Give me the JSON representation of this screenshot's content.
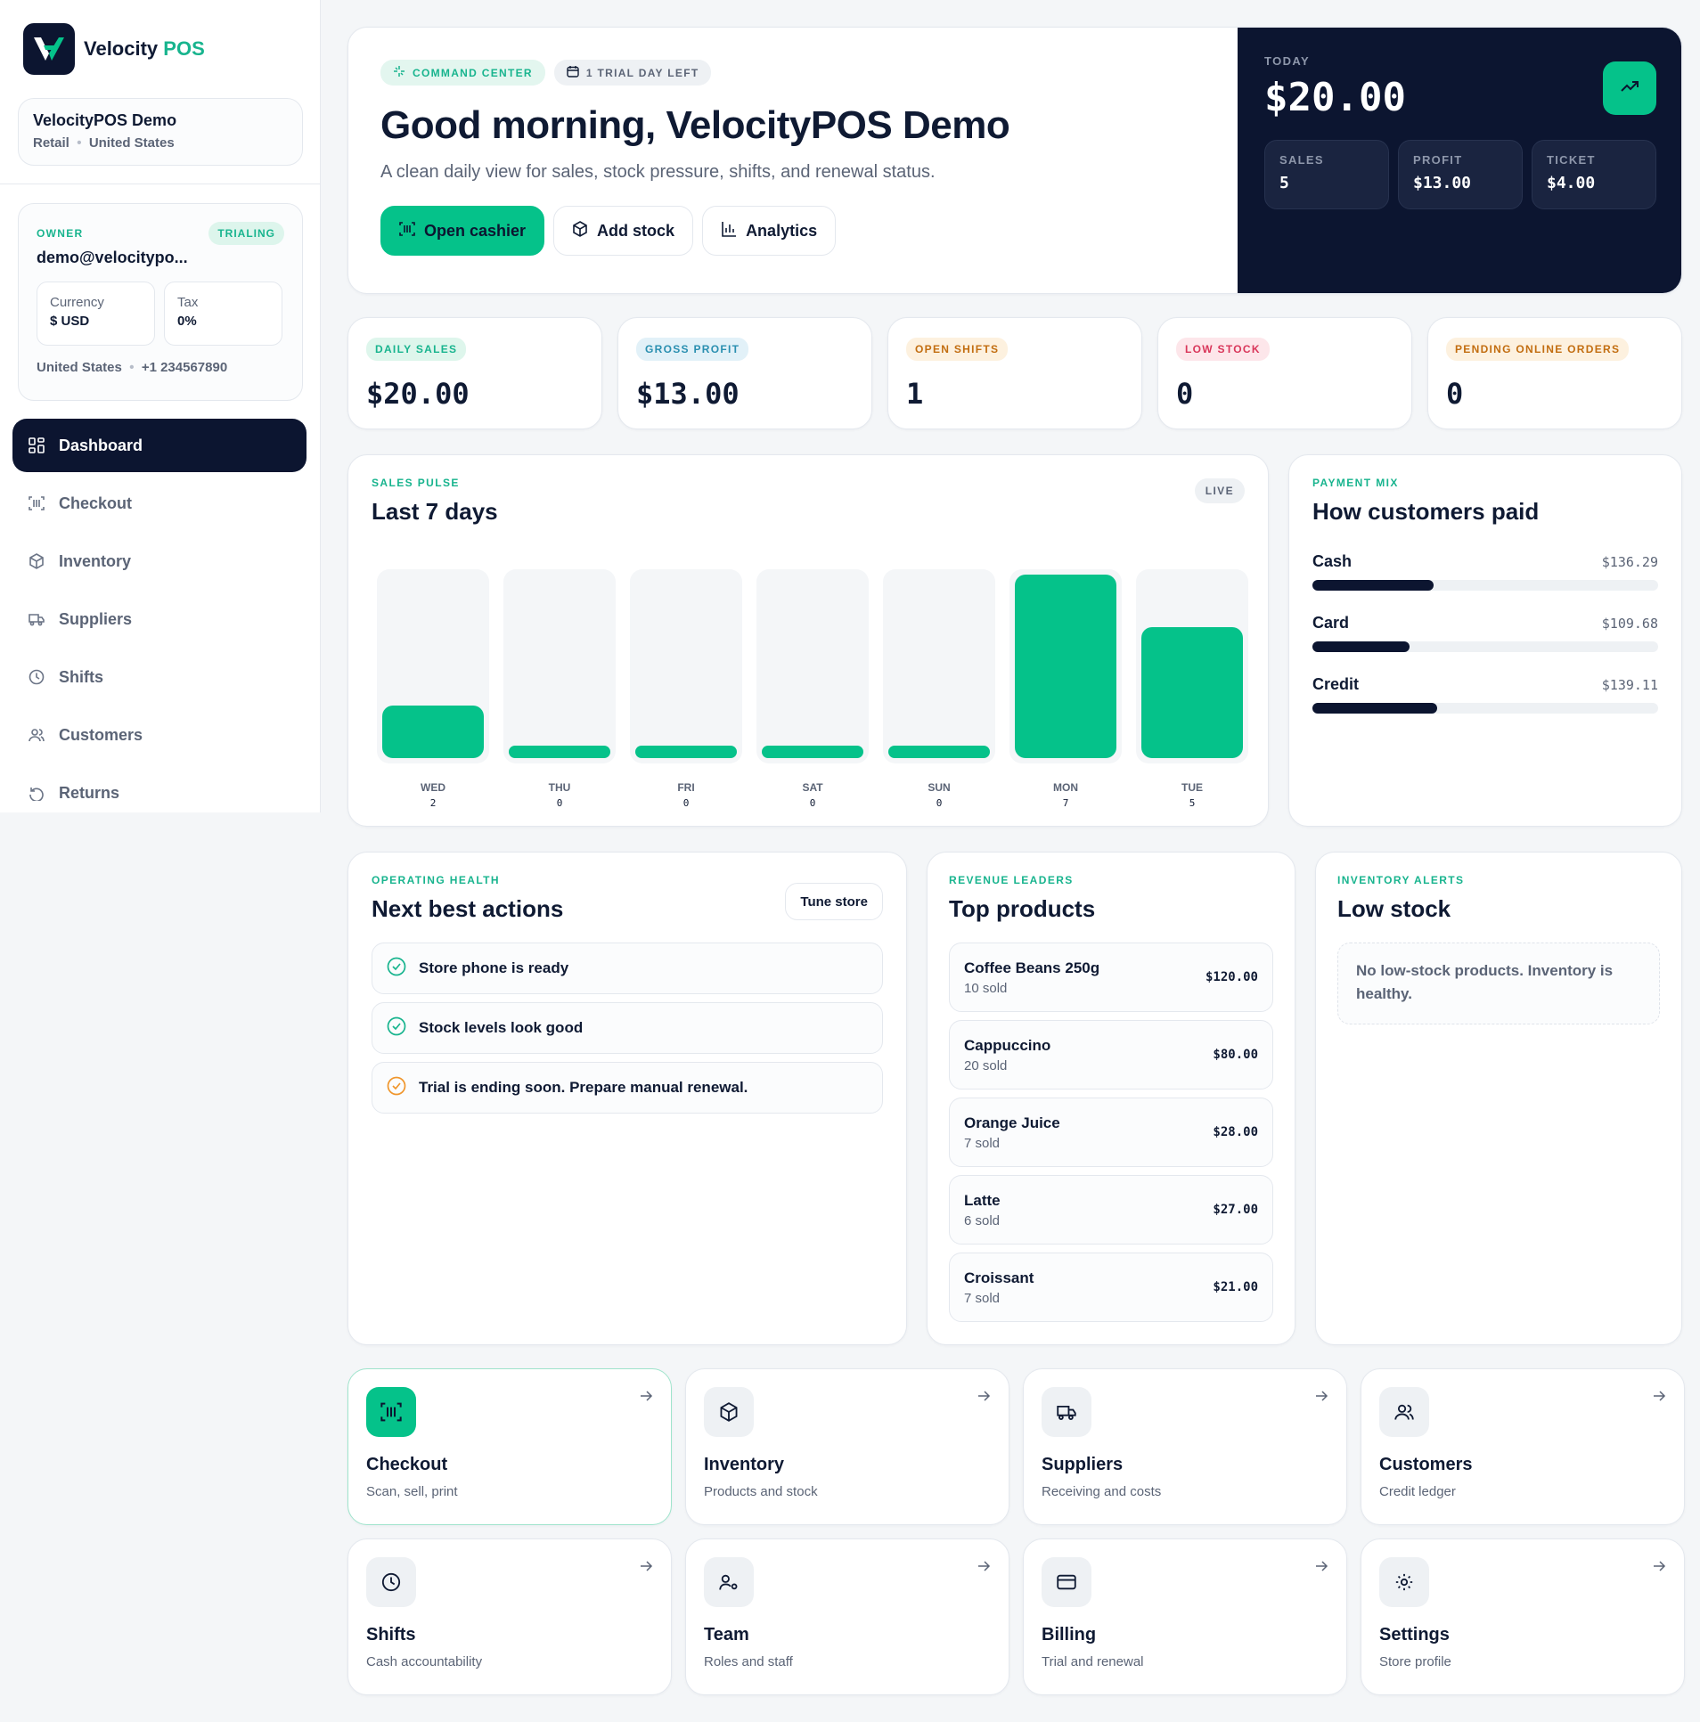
{
  "brand": {
    "name": "Velocity",
    "accent": "POS"
  },
  "store": {
    "name": "VelocityPOS Demo",
    "type": "Retail",
    "country": "United States"
  },
  "owner": {
    "role": "OWNER",
    "status": "TRIALING",
    "email": "demo@velocitypo...",
    "currency_label": "Currency",
    "currency_value": "$ USD",
    "tax_label": "Tax",
    "tax_value": "0%",
    "country": "United States",
    "phone": "+1 234567890"
  },
  "nav": [
    {
      "label": "Dashboard",
      "icon": "grid-icon",
      "active": true
    },
    {
      "label": "Checkout",
      "icon": "barcode-icon"
    },
    {
      "label": "Inventory",
      "icon": "box-icon"
    },
    {
      "label": "Suppliers",
      "icon": "truck-icon"
    },
    {
      "label": "Shifts",
      "icon": "clock-icon"
    },
    {
      "label": "Customers",
      "icon": "users-icon"
    },
    {
      "label": "Returns",
      "icon": "undo-icon"
    }
  ],
  "hero": {
    "chip_command": "COMMAND CENTER",
    "chip_trial": "1 TRIAL DAY LEFT",
    "title": "Good morning, VelocityPOS Demo",
    "subtitle": "A clean daily view for sales, stock pressure, shifts, and renewal status.",
    "btn_cashier": "Open cashier",
    "btn_stock": "Add stock",
    "btn_analytics": "Analytics"
  },
  "today": {
    "label": "TODAY",
    "value": "$20.00",
    "sales_label": "SALES",
    "sales_value": "5",
    "profit_label": "PROFIT",
    "profit_value": "$13.00",
    "ticket_label": "TICKET",
    "ticket_value": "$4.00"
  },
  "kpis": [
    {
      "label": "DAILY SALES",
      "value": "$20.00",
      "bg": "#def6ec",
      "fg": "#18b48e"
    },
    {
      "label": "GROSS PROFIT",
      "value": "$13.00",
      "bg": "#e2f1f8",
      "fg": "#2a8fb0"
    },
    {
      "label": "OPEN SHIFTS",
      "value": "1",
      "bg": "#fdf1df",
      "fg": "#c26d10"
    },
    {
      "label": "LOW STOCK",
      "value": "0",
      "bg": "#fde6ea",
      "fg": "#d9365a"
    },
    {
      "label": "PENDING ONLINE ORDERS",
      "value": "0",
      "bg": "#fdf1df",
      "fg": "#c26d10"
    }
  ],
  "pulse": {
    "eyebrow": "SALES PULSE",
    "title": "Last 7 days",
    "badge": "LIVE",
    "chart_data": {
      "type": "bar",
      "categories": [
        "WED",
        "THU",
        "FRI",
        "SAT",
        "SUN",
        "MON",
        "TUE"
      ],
      "values": [
        2,
        0,
        0,
        0,
        0,
        7,
        5
      ],
      "title": "Last 7 days",
      "xlabel": "",
      "ylabel": ""
    }
  },
  "paymix": {
    "eyebrow": "PAYMENT MIX",
    "title": "How customers paid",
    "items": [
      {
        "label": "Cash",
        "amount": "$136.29",
        "share": 0.35
      },
      {
        "label": "Card",
        "amount": "$109.68",
        "share": 0.28
      },
      {
        "label": "Credit",
        "amount": "$139.11",
        "share": 0.36
      }
    ]
  },
  "health": {
    "eyebrow": "OPERATING HEALTH",
    "title": "Next best actions",
    "tune": "Tune store",
    "items": [
      {
        "text": "Store phone is ready",
        "state": "ok"
      },
      {
        "text": "Stock levels look good",
        "state": "ok"
      },
      {
        "text": "Trial is ending soon. Prepare manual renewal.",
        "state": "warn"
      }
    ]
  },
  "products": {
    "eyebrow": "REVENUE LEADERS",
    "title": "Top products",
    "items": [
      {
        "name": "Coffee Beans 250g",
        "sold": "10 sold",
        "amount": "$120.00"
      },
      {
        "name": "Cappuccino",
        "sold": "20 sold",
        "amount": "$80.00"
      },
      {
        "name": "Orange Juice",
        "sold": "7 sold",
        "amount": "$28.00"
      },
      {
        "name": "Latte",
        "sold": "6 sold",
        "amount": "$27.00"
      },
      {
        "name": "Croissant",
        "sold": "7 sold",
        "amount": "$21.00"
      }
    ]
  },
  "lowstock": {
    "eyebrow": "INVENTORY ALERTS",
    "title": "Low stock",
    "empty": "No low-stock products. Inventory is healthy."
  },
  "tiles": [
    {
      "title": "Checkout",
      "sub": "Scan, sell, print",
      "icon": "barcode-icon",
      "highlight": true
    },
    {
      "title": "Inventory",
      "sub": "Products and stock",
      "icon": "box-icon"
    },
    {
      "title": "Suppliers",
      "sub": "Receiving and costs",
      "icon": "truck-icon"
    },
    {
      "title": "Customers",
      "sub": "Credit ledger",
      "icon": "users-icon"
    },
    {
      "title": "Shifts",
      "sub": "Cash accountability",
      "icon": "clock-icon"
    },
    {
      "title": "Team",
      "sub": "Roles and staff",
      "icon": "user-gear-icon"
    },
    {
      "title": "Billing",
      "sub": "Trial and renewal",
      "icon": "card-icon"
    },
    {
      "title": "Settings",
      "sub": "Store profile",
      "icon": "gear-icon"
    }
  ],
  "colors": {
    "accent": "#05c28a",
    "navy": "#0c1530",
    "muted": "#5b6476"
  }
}
